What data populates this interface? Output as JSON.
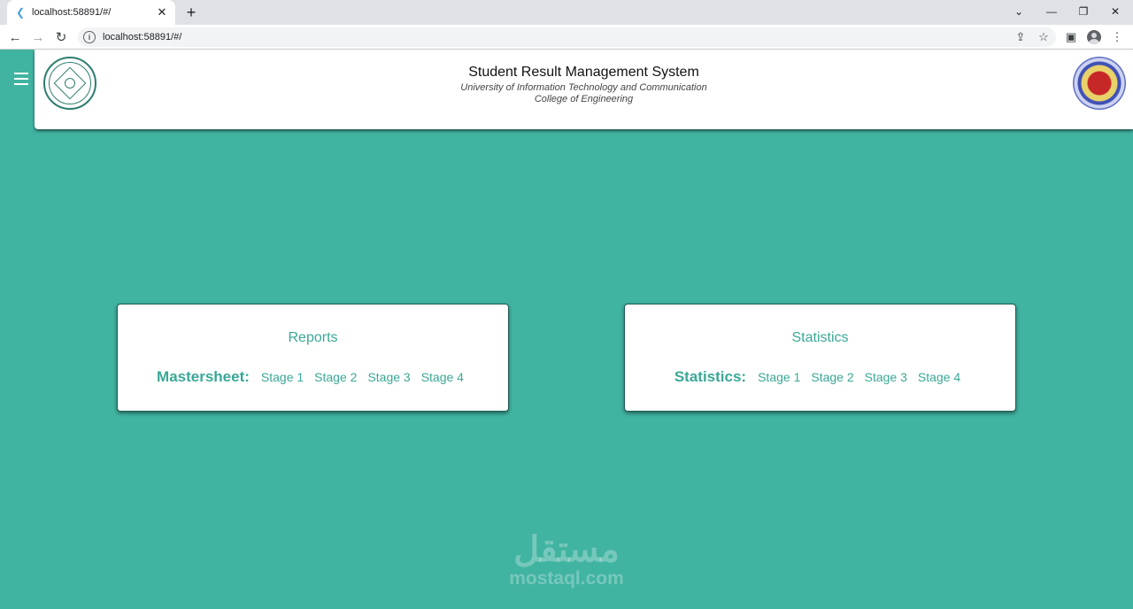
{
  "browser": {
    "tab_title": "localhost:58891/#/",
    "new_tab": "+",
    "url": "localhost:58891/#/"
  },
  "header": {
    "title": "Student Result Management System",
    "university": "University of Information Technology and Communication",
    "college": "College of Engineering"
  },
  "cards": {
    "reports": {
      "title": "Reports",
      "row_label": "Mastersheet:",
      "stages": [
        "Stage 1",
        "Stage 2",
        "Stage 3",
        "Stage 4"
      ]
    },
    "statistics": {
      "title": "Statistics",
      "row_label": "Statistics:",
      "stages": [
        "Stage 1",
        "Stage 2",
        "Stage 3",
        "Stage 4"
      ]
    }
  },
  "watermark": {
    "arabic": "مستقل",
    "latin": "mostaql.com"
  },
  "colors": {
    "background": "#41b3a1",
    "accent_text": "#3aa896",
    "card": "#ffffff"
  }
}
